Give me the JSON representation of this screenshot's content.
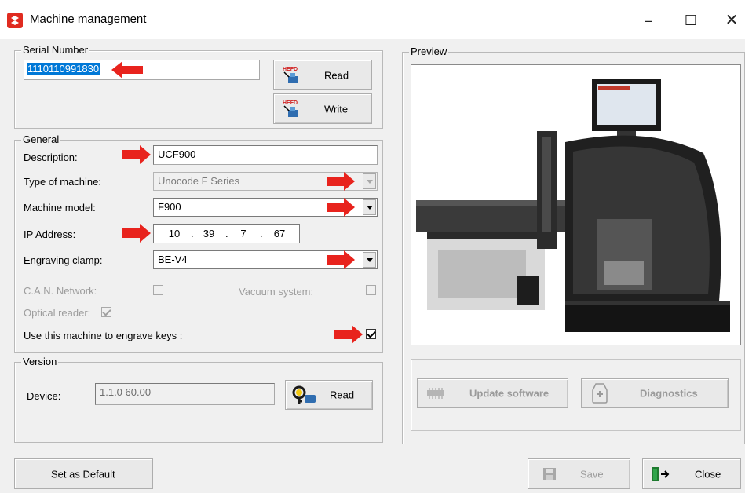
{
  "window": {
    "title": "Machine management",
    "minimize": "–",
    "maximize": "☐",
    "close": "✕"
  },
  "serial": {
    "group_label": "Serial Number",
    "value": "1110110991830",
    "read_label": "Read",
    "write_label": "Write",
    "icon_text": "HEFD"
  },
  "general": {
    "group_label": "General",
    "description_label": "Description:",
    "description_value": "UCF900",
    "type_label": "Type of machine:",
    "type_value": "Unocode F Series",
    "model_label": "Machine model:",
    "model_value": "F900",
    "ip_label": "IP Address:",
    "ip": [
      "10",
      "39",
      "7",
      "67"
    ],
    "ip_dot": ".",
    "clamp_label": "Engraving clamp:",
    "clamp_value": "BE-V4",
    "can_label": "C.A.N. Network:",
    "vacuum_label": "Vacuum system:",
    "optical_label": "Optical reader:",
    "engrave_label": "Use this machine to engrave keys :"
  },
  "version": {
    "group_label": "Version",
    "device_label": "Device:",
    "device_value": "1.1.0 60.00",
    "read_label": "Read"
  },
  "preview": {
    "group_label": "Preview",
    "update_label": "Update software",
    "diagnostics_label": "Diagnostics"
  },
  "footer": {
    "default_label": "Set as Default",
    "save_label": "Save",
    "close_label": "Close"
  },
  "colors": {
    "arrow": "#e8231d",
    "selection": "#0078d7",
    "accent": "#e02b20"
  }
}
